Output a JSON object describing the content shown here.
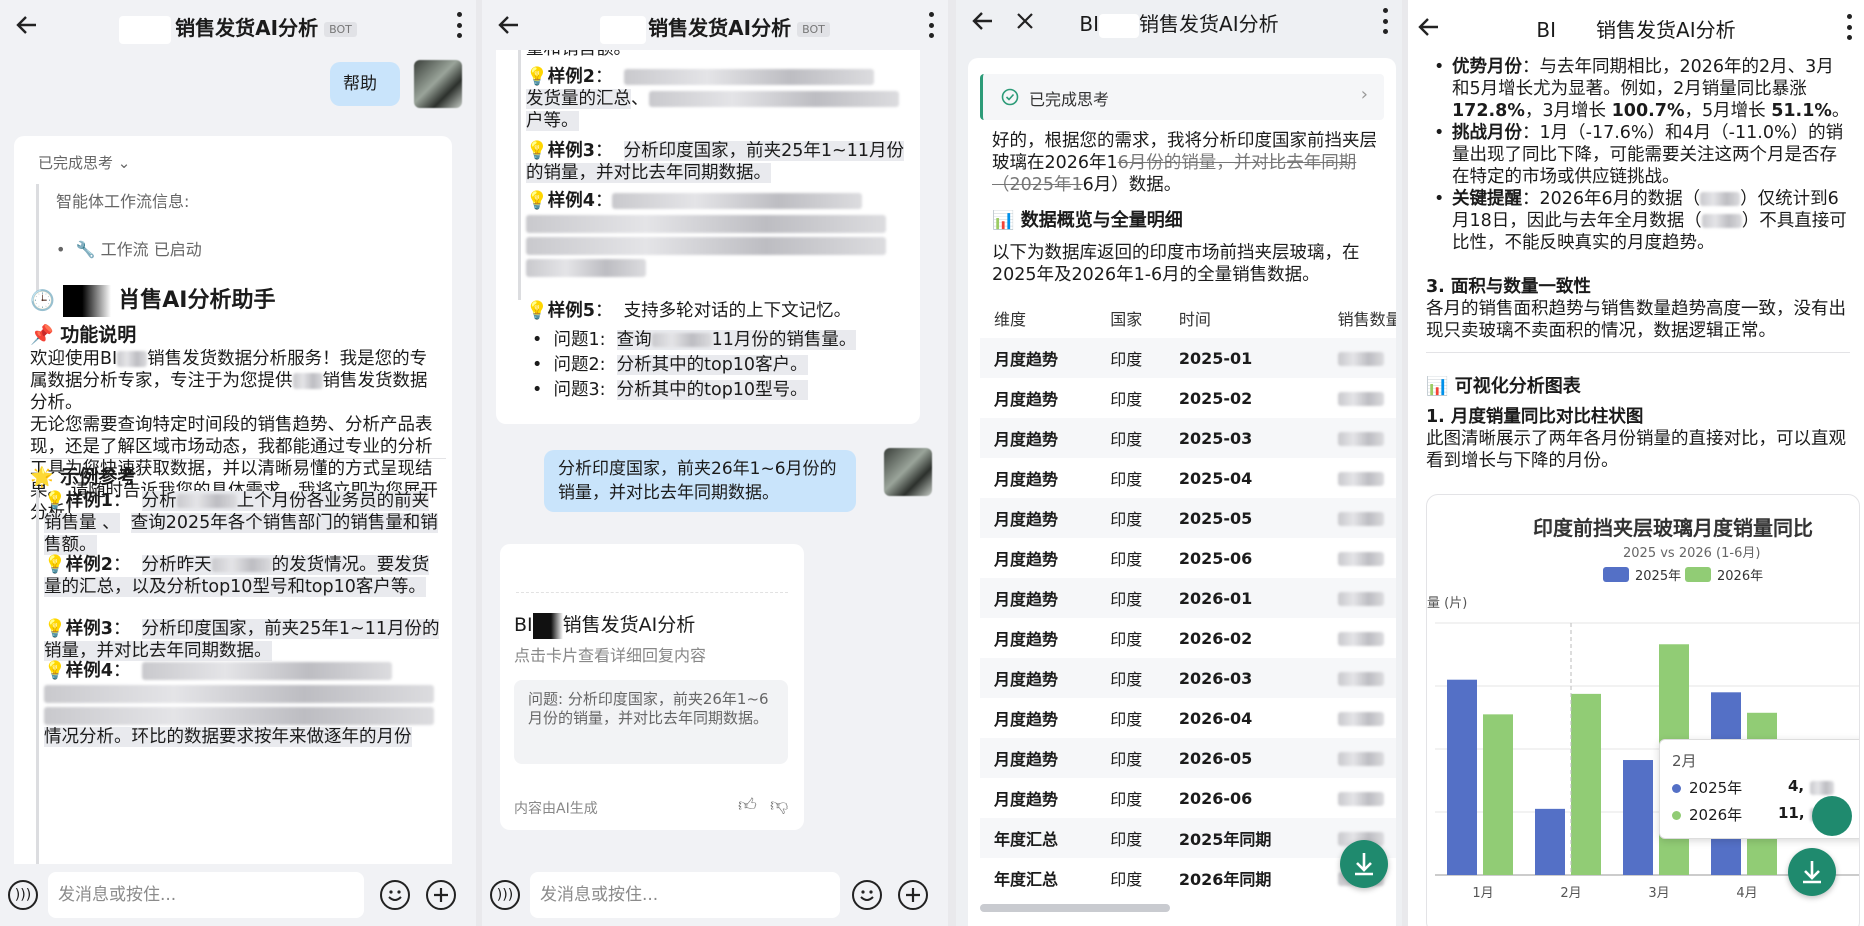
{
  "p1": {
    "title": "销售发货AI分析",
    "bot_tag": "BOT",
    "user_msg": "帮助",
    "think_toggle": "已完成思考",
    "workflow_label": "智能体工作流信息:",
    "workflow_status": "工作流 已启动",
    "assistant_title": "肖售AI分析助手",
    "feature_heading": "功能说明",
    "intro_1": "欢迎使用BI",
    "intro_2": "销售发货数据分析服务！我是您的专属数据分析专家，专注于为您提供",
    "intro_3": "销售发货数据分析。",
    "intro_4": "无论您需要查询特定时间段的销售趋势、分析产品表现，还是了解区域市场动态，我都能通过专业的分析工具为您快速获取数据，并以清晰易懂的方式呈现结果。 请随时告诉我您的具体需求，我将立即为您展开分析！",
    "examples_heading": "示例参考",
    "ex1_label": "样例1",
    "ex1_a": "分析",
    "ex1_b": "上个月份各业务员的前夹销售量 、",
    "ex1_c": "查询2025年各个销售部门的销售量和销售额。",
    "ex2_label": "样例2",
    "ex2_a": "分析昨天",
    "ex2_b": "的发货情况。要发货量的汇总，以及分析top10型号和top10客户等。",
    "ex3_label": "样例3",
    "ex3_text": "分析印度国家，前夹25年1~11月份的销量，并对比去年同期数据。",
    "ex4_label": "样例4",
    "ex4_tail": "情况分析。环比的数据要求按年来做逐年的月份",
    "input_placeholder": "发消息或按住..."
  },
  "p2": {
    "title": "销售发货AI分析",
    "bot_tag": "BOT",
    "top_cut": "量和销售额。",
    "ex2_label": "样例2",
    "ex2_text": "发货量的汇总",
    "ex2_tail": "户等。",
    "ex3_label": "样例3",
    "ex3_text": "分析印度国家，前夹25年1~11月份的销量，并对比去年同期数据。",
    "ex4_label": "样例4",
    "ex5_label": "样例5",
    "ex5_text": "支持多轮对话的上下文记忆。",
    "q1_label": "问题1:",
    "q1_a": "查询",
    "q1_b": "11月份的销售量。",
    "q2_label": "问题2:",
    "q2_text": "分析其中的top10客户。",
    "q3_label": "问题3:",
    "q3_text": "分析其中的top10型号。",
    "user_msg": "分析印度国家，前夹26年1~6月份的销量，并对比去年同期数据。",
    "card_title_a": "BI",
    "card_title_b": "销售发货AI分析",
    "card_sub": "点击卡片查看详细回复内容",
    "card_question": "问题: 分析印度国家，前夹26年1~6月份的销量，并对比去年同期数据。",
    "card_footer": "内容由AI生成",
    "input_placeholder": "发消息或按住..."
  },
  "p3": {
    "title_a": "BI",
    "title_b": "销售发货AI分析",
    "think": "已完成思考",
    "reply_a": "好的，根据您的需求，我将分析印度国家前挡夹层玻璃在2026年1",
    "reply_strike": "6月份的销量，并对比去年同期（2025年1",
    "reply_b": "6月）数据。",
    "section_title": "数据概览与全量明细",
    "section_desc": "以下为数据库返回的印度市场前挡夹层玻璃，在2025年及2026年1-6月的全量销售数据。",
    "columns": [
      "维度",
      "国家",
      "时间",
      "销售数量"
    ],
    "rows": [
      {
        "dim": "月度趋势",
        "country": "印度",
        "time": "2025-01"
      },
      {
        "dim": "月度趋势",
        "country": "印度",
        "time": "2025-02"
      },
      {
        "dim": "月度趋势",
        "country": "印度",
        "time": "2025-03"
      },
      {
        "dim": "月度趋势",
        "country": "印度",
        "time": "2025-04"
      },
      {
        "dim": "月度趋势",
        "country": "印度",
        "time": "2025-05"
      },
      {
        "dim": "月度趋势",
        "country": "印度",
        "time": "2025-06"
      },
      {
        "dim": "月度趋势",
        "country": "印度",
        "time": "2026-01"
      },
      {
        "dim": "月度趋势",
        "country": "印度",
        "time": "2026-02"
      },
      {
        "dim": "月度趋势",
        "country": "印度",
        "time": "2026-03"
      },
      {
        "dim": "月度趋势",
        "country": "印度",
        "time": "2026-04"
      },
      {
        "dim": "月度趋势",
        "country": "印度",
        "time": "2026-05"
      },
      {
        "dim": "月度趋势",
        "country": "印度",
        "time": "2026-06"
      },
      {
        "dim": "年度汇总",
        "country": "印度",
        "time": "2025年同期"
      },
      {
        "dim": "年度汇总",
        "country": "印度",
        "time": "2026年同期"
      }
    ]
  },
  "p4": {
    "title_a": "BI",
    "title_b": "销售发货AI分析",
    "b1_label": "优势月份",
    "b1_text": "：与去年同期相比，2026年的2月、3月和5月增长尤为显著。例如，2月销量同比暴涨 ",
    "b1_v1": "172.8%",
    "b1_mid": "，3月增长 ",
    "b1_v2": "100.7%",
    "b1_mid2": "，5月增长 ",
    "b1_v3": "51.1%",
    "b1_end": "。",
    "b2_label": "挑战月份",
    "b2_text": "：1月（-17.6%）和4月（-11.0%）的销量出现了同比下降，可能需要关注这两个月是否存在特定的市场或供应链挑战。",
    "b3_label": "关键提醒",
    "b3_a": "：2026年6月的数据（",
    "b3_b": "）仅统计到6月18日，因此与去年全月数据（",
    "b3_c": "）不具直接可比性，不能反映真实的月度趋势。",
    "sec3_title": "3. 面积与数量一致性",
    "sec3_text": "各月的销售面积趋势与销售数量趋势高度一致，没有出现只卖玻璃不卖面积的情况，数据逻辑正常。",
    "viz_title": "可视化分析图表",
    "chart1_title": "1. 月度销量同比对比柱状图",
    "chart1_desc": "此图清晰展示了两年各月份销量的直接对比，可以直观看到增长与下降的月份。",
    "tooltip_month": "2月",
    "tooltip_2025": "2025年",
    "tooltip_2025_val": "4,",
    "tooltip_2026": "2026年",
    "tooltip_2026_val": "11,"
  },
  "chart_data": {
    "type": "bar",
    "title": "印度前挡夹层玻璃月度销量同比",
    "subtitle": "2025 vs 2026 (1-6月)",
    "ylabel": "量 (片)",
    "categories": [
      "1月",
      "2月",
      "3月",
      "4月"
    ],
    "series": [
      {
        "name": "2025年",
        "color": "#5470c6",
        "values": [
          12400,
          4200,
          7300,
          11600
        ]
      },
      {
        "name": "2026年",
        "color": "#91cc75",
        "values": [
          10200,
          11500,
          14650,
          10300
        ]
      }
    ],
    "ylim": [
      0,
      16000
    ],
    "legend": "top",
    "grid": true
  },
  "colors": {
    "accent_green": "#1f8a6e",
    "user_bubble": "#c9e4fb",
    "series_2025": "#5470c6",
    "series_2026": "#91cc75"
  }
}
